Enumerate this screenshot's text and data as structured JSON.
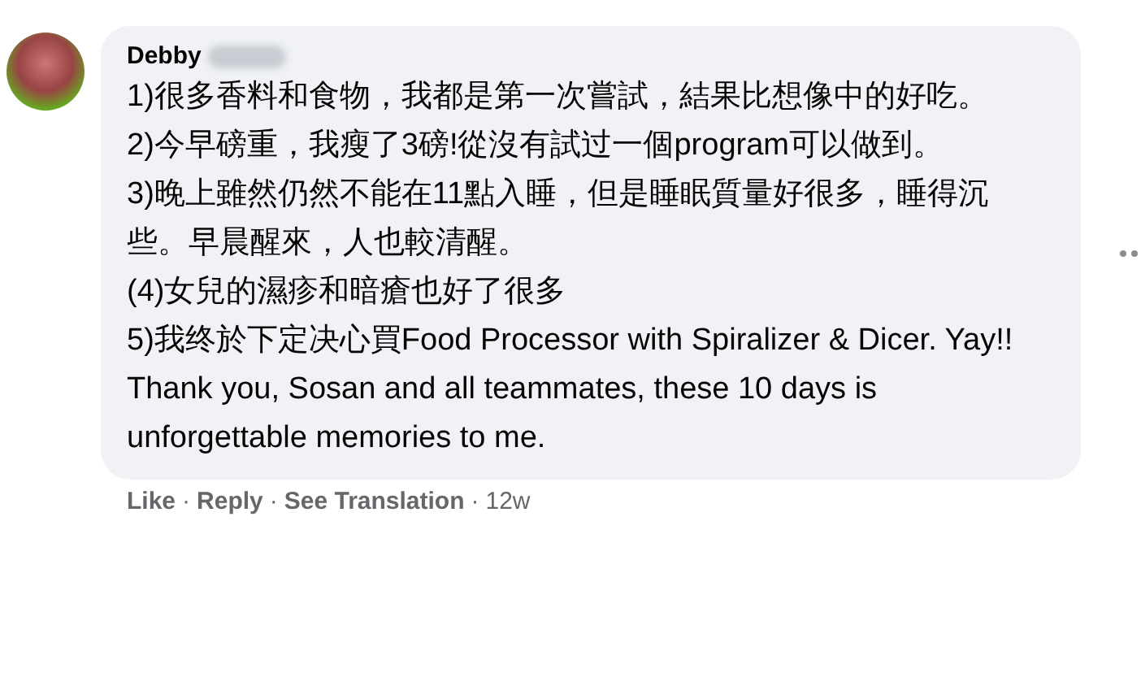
{
  "comment": {
    "author": "Debby",
    "author_surname_hidden": true,
    "paragraphs": [
      "1)很多香料和食物，我都是第一次嘗試，結果比想像中的好吃。",
      "2)今早磅重，我瘦了3磅!從沒有試过一個program可以做到。",
      "3)晚上雖然仍然不能在11點入睡，但是睡眠質量好很多，睡得沉些。早晨醒來，人也較清醒。",
      "(4)女兒的濕疹和暗瘡也好了很多",
      "5)我终於下定决心買Food Processor with Spiralizer & Dicer. Yay!!",
      "Thank you, Sosan and all teammates, these 10 days is unforgettable memories to me."
    ],
    "actions": [
      "Like",
      "Reply",
      "See Translation"
    ],
    "separator": "·",
    "time": "12w"
  }
}
